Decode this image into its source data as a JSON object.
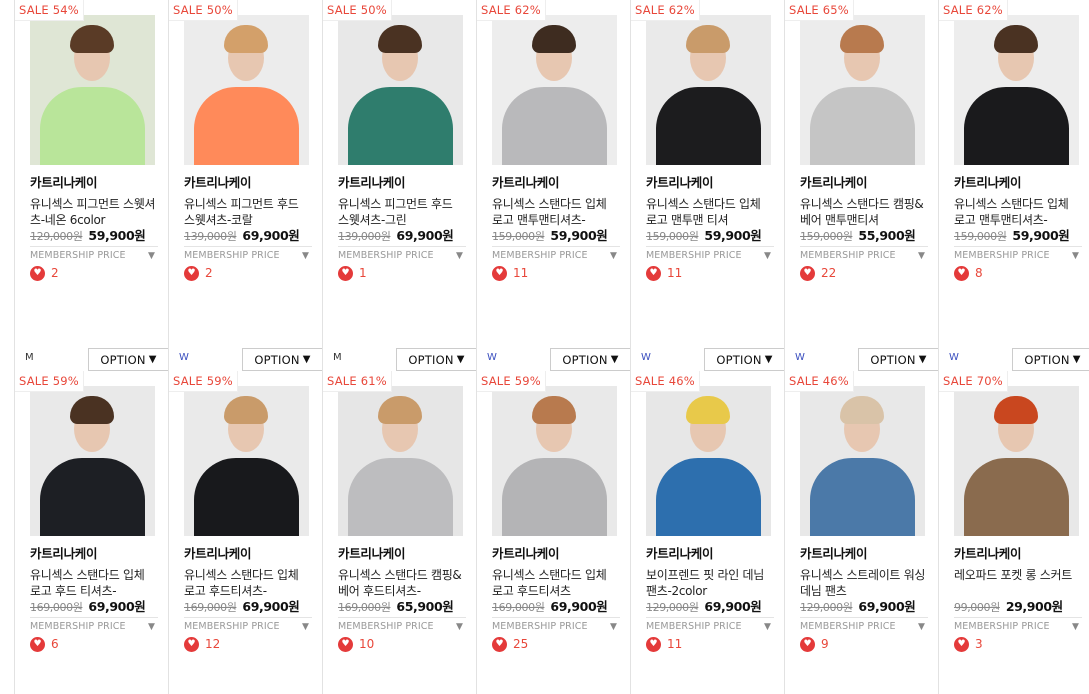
{
  "membership_label": "MEMBERSHIP PRICE",
  "option_label": "OPTION",
  "option_icon": "caret-down-icon",
  "heart_icon": "heart-icon",
  "row1": [
    {
      "sale": "SALE 54%",
      "brand": "카트리나케이",
      "name": "유니섹스 피그먼트 스웻셔츠-네온 6color",
      "orig": "129,000원",
      "price": "59,900원",
      "likes": "2",
      "gender": "M",
      "colors": [
        "#dfe6d5",
        "#b9e59a",
        "#5a3b26"
      ]
    },
    {
      "sale": "SALE 50%",
      "brand": "카트리나케이",
      "name": "유니섹스 피그먼트 후드 스웻셔츠-코랄",
      "orig": "139,000원",
      "price": "69,900원",
      "likes": "2",
      "gender": "W",
      "colors": [
        "#ececec",
        "#ff8a5a",
        "#d3a06a"
      ]
    },
    {
      "sale": "SALE 50%",
      "brand": "카트리나케이",
      "name": "유니섹스 피그먼트 후드 스웻셔츠-그린",
      "orig": "139,000원",
      "price": "69,900원",
      "likes": "1",
      "gender": "M",
      "colors": [
        "#e8e8e8",
        "#2f7d6d",
        "#4a3222"
      ]
    },
    {
      "sale": "SALE 62%",
      "brand": "카트리나케이",
      "name": "유니섹스 스탠다드 입체 로고 맨투맨티셔츠-",
      "orig": "159,000원",
      "price": "59,900원",
      "likes": "11",
      "gender": "W",
      "colors": [
        "#ededed",
        "#b9b9bb",
        "#3e2c20"
      ]
    },
    {
      "sale": "SALE 62%",
      "brand": "카트리나케이",
      "name": "유니섹스 스탠다드 입체 로고 맨투맨 티셔",
      "orig": "159,000원",
      "price": "59,900원",
      "likes": "11",
      "gender": "W",
      "colors": [
        "#eaeaea",
        "#1c1c1e",
        "#c99b6a"
      ]
    },
    {
      "sale": "SALE 65%",
      "brand": "카트리나케이",
      "name": "유니섹스 스탠다드 캠핑&베어 맨투맨티셔",
      "orig": "159,000원",
      "price": "55,900원",
      "likes": "22",
      "gender": "W",
      "colors": [
        "#ececec",
        "#c5c5c5",
        "#b87a4e"
      ]
    },
    {
      "sale": "SALE 62%",
      "brand": "카트리나케이",
      "name": "유니섹스 스탠다드 입체 로고 맨투맨티셔츠-",
      "orig": "159,000원",
      "price": "59,900원",
      "likes": "8",
      "gender": "W",
      "colors": [
        "#ededed",
        "#1a1a1c",
        "#4a3222"
      ]
    }
  ],
  "row2": [
    {
      "sale": "SALE 59%",
      "brand": "카트리나케이",
      "name": "유니섹스 스탠다드 입체 로고 후드 티셔츠-",
      "orig": "169,000원",
      "price": "69,900원",
      "likes": "6",
      "colors": [
        "#e9e9e9",
        "#1d1f24",
        "#4a3222"
      ]
    },
    {
      "sale": "SALE 59%",
      "brand": "카트리나케이",
      "name": "유니섹스 스탠다드 입체 로고 후드티셔츠-",
      "orig": "169,000원",
      "price": "69,900원",
      "likes": "12",
      "colors": [
        "#eaeaea",
        "#18191c",
        "#c99b6a"
      ]
    },
    {
      "sale": "SALE 61%",
      "brand": "카트리나케이",
      "name": "유니섹스 스탠다드 캠핑&베어 후드티셔츠-",
      "orig": "169,000원",
      "price": "65,900원",
      "likes": "10",
      "colors": [
        "#e6e6e6",
        "#bdbdbf",
        "#c99b6a"
      ]
    },
    {
      "sale": "SALE 59%",
      "brand": "카트리나케이",
      "name": "유니섹스 스탠다드 입체 로고 후드티셔츠",
      "orig": "169,000원",
      "price": "69,900원",
      "likes": "25",
      "colors": [
        "#e9e9e9",
        "#b4b4b6",
        "#b87a4e"
      ]
    },
    {
      "sale": "SALE 46%",
      "brand": "카트리나케이",
      "name": "보이프렌드 핏 라인 데님 팬츠-2color",
      "orig": "129,000원",
      "price": "69,900원",
      "likes": "11",
      "colors": [
        "#e7e7e7",
        "#2d6fae",
        "#e8c94a"
      ]
    },
    {
      "sale": "SALE 46%",
      "brand": "카트리나케이",
      "name": "유니섹스 스트레이트 워싱 데님 팬츠",
      "orig": "129,000원",
      "price": "69,900원",
      "likes": "9",
      "colors": [
        "#e8e8e8",
        "#4b79a8",
        "#d9c3a8"
      ]
    },
    {
      "sale": "SALE 70%",
      "brand": "카트리나케이",
      "name": "레오파드 포켓 롱 스커트",
      "orig": "99,000원",
      "price": "29,900원",
      "likes": "3",
      "colors": [
        "#e8e8e8",
        "#8a6b4e",
        "#c9471f"
      ]
    }
  ]
}
